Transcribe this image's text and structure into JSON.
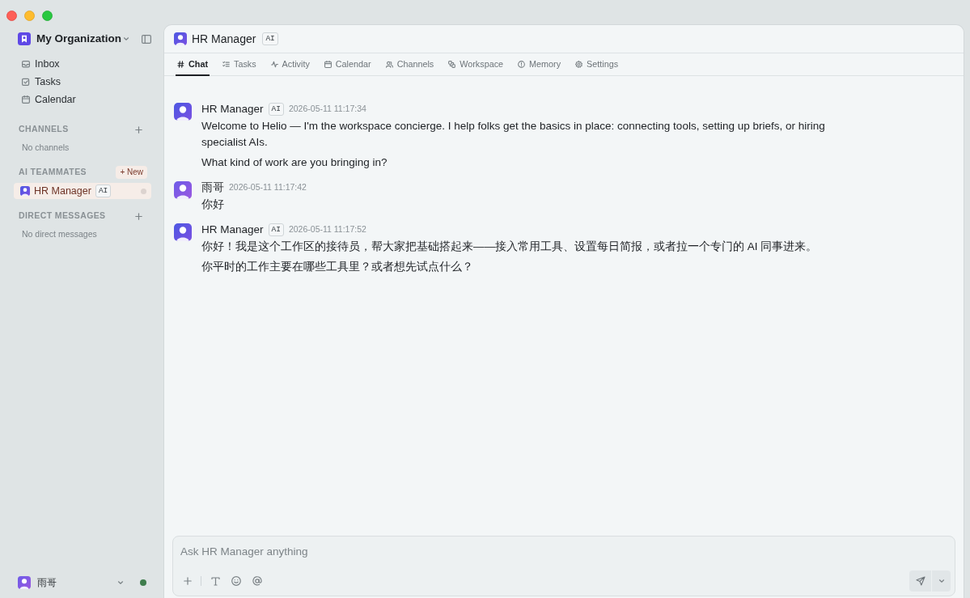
{
  "sidebar": {
    "organization": {
      "name": "My Organization"
    },
    "nav": [
      {
        "label": "Inbox"
      },
      {
        "label": "Tasks"
      },
      {
        "label": "Calendar"
      }
    ],
    "sections": [
      {
        "title": "CHANNELS",
        "empty_text": "No channels"
      },
      {
        "title": "AI TEAMMATES",
        "new_button": "+ New",
        "items": [
          {
            "name": "HR Manager",
            "badge": "AI",
            "selected": true,
            "online": false
          }
        ]
      },
      {
        "title": "DIRECT MESSAGES",
        "empty_text": "No direct messages"
      }
    ],
    "user": {
      "name": "雨哥",
      "online": true
    }
  },
  "conversation": {
    "title": "HR Manager",
    "badge": "AI",
    "tabs": [
      {
        "label": "Chat",
        "selected": true
      },
      {
        "label": "Tasks",
        "selected": false
      },
      {
        "label": "Activity",
        "selected": false
      },
      {
        "label": "Calendar",
        "selected": false
      },
      {
        "label": "Channels",
        "selected": false
      },
      {
        "label": "Workspace",
        "selected": false
      },
      {
        "label": "Memory",
        "selected": false
      },
      {
        "label": "Settings",
        "selected": false
      }
    ],
    "messages": [
      {
        "author": "HR Manager",
        "badge": "AI",
        "time": "2026-05-11 11:17:34",
        "paragraphs": [
          "Welcome to Helio — I'm the workspace concierge. I help folks get the basics in place: connecting tools, setting up briefs, or hiring specialist AIs.",
          "What kind of work are you bringing in?"
        ]
      },
      {
        "author": "雨哥",
        "time": "2026-05-11 11:17:42",
        "paragraphs": [
          "你好"
        ]
      },
      {
        "author": "HR Manager",
        "badge": "AI",
        "time": "2026-05-11 11:17:52",
        "paragraphs": [
          "你好！我是这个工作区的接待员，帮大家把基础搭起来——接入常用工具、设置每日简报，或者拉一个专门的 AI 同事进来。",
          "你平时的工作主要在哪些工具里？或者想先试点什么？"
        ]
      }
    ],
    "composer": {
      "placeholder": "Ask HR Manager anything"
    }
  }
}
